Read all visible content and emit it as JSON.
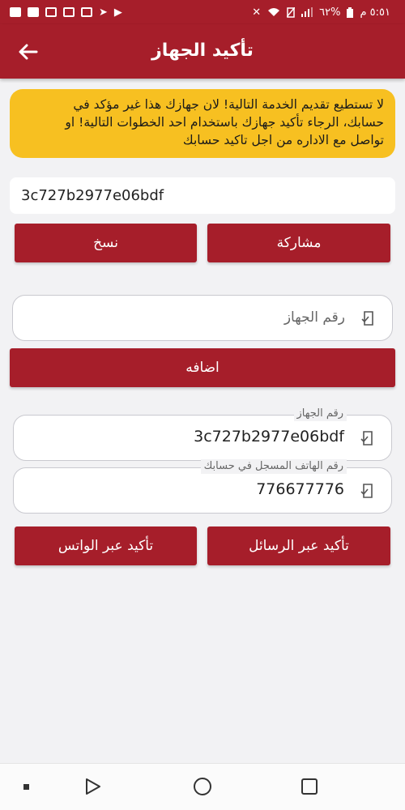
{
  "status_bar": {
    "time": "٥:٥١ م",
    "battery": "٦٢%"
  },
  "header": {
    "title": "تأكيد الجهاز",
    "back_icon": "arrow-left-icon"
  },
  "warning": {
    "line1": "لا تستطيع تقديم الخدمة التالية! لان جهازك هذا غير مؤكد في",
    "line2": "حسابك، الرجاء تأكيد جهازك باستخدام احد الخطوات التالية! او",
    "line3": "تواصل مع الاداره من اجل تاكيد حسابك"
  },
  "device_code": "3c727b2977e06bdf",
  "buttons": {
    "share": "مشاركة",
    "copy": "نسخ",
    "add": "اضافه",
    "confirm_sms": "تأكيد عبر الرسائل",
    "confirm_whatsapp": "تأكيد عبر الواتس"
  },
  "device_input": {
    "placeholder": "رقم الجهاز"
  },
  "device_number_field": {
    "label": "رقم الجهاز",
    "value": "3c727b2977e06bdf"
  },
  "phone_field": {
    "label": "رقم الهاتف المسجل في حسابك",
    "value": "776677776"
  },
  "colors": {
    "primary": "#a61e2a",
    "warning": "#f7c021",
    "background": "#f2f2f4"
  }
}
